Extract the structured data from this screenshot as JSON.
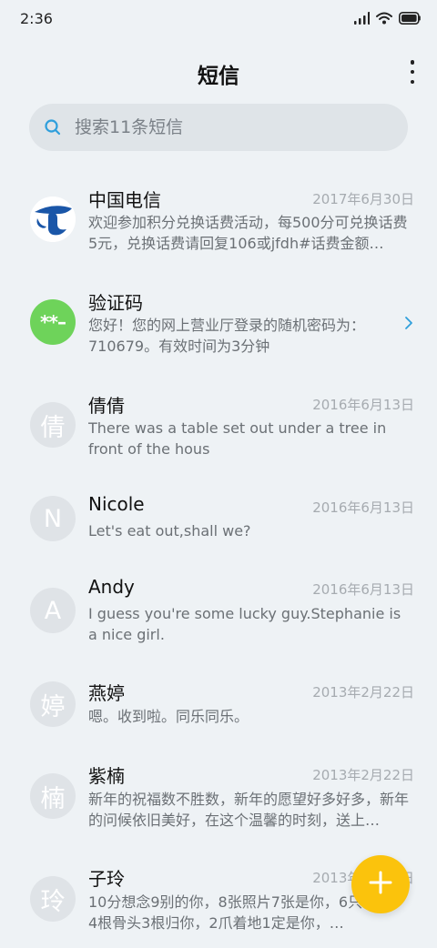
{
  "status_bar": {
    "time": "2:36"
  },
  "header": {
    "title": "短信"
  },
  "search": {
    "placeholder": "搜索11条短信"
  },
  "messages": [
    {
      "avatar_type": "logo",
      "avatar_icon": "china-telecom-logo",
      "sender": "中国电信",
      "date": "2017年6月30日",
      "preview": "欢迎参加积分兑换话费活动，每500分可兑换话费5元，兑换话费请回复106或jfdh#话费金额…"
    },
    {
      "avatar_type": "green",
      "avatar_text": "**–",
      "sender": "验证码",
      "date": "",
      "preview": "您好！您的网上营业厅登录的随机密码为：710679。有效时间为3分钟",
      "has_chevron": true
    },
    {
      "avatar_type": "letter",
      "avatar_text": "倩",
      "sender": "倩倩",
      "date": "2016年6月13日",
      "preview": "There was a table set out under a tree in front of the hous"
    },
    {
      "avatar_type": "letter",
      "avatar_text": "N",
      "sender": "Nicole",
      "date": "2016年6月13日",
      "preview": "Let's eat out,shall we?"
    },
    {
      "avatar_type": "letter",
      "avatar_text": "A",
      "sender": "Andy",
      "date": "2016年6月13日",
      "preview": "I guess you're some lucky guy.Stephanie is a nice girl."
    },
    {
      "avatar_type": "letter",
      "avatar_text": "婷",
      "sender": "燕婷",
      "date": "2013年2月22日",
      "preview": "嗯。收到啦。同乐同乐。"
    },
    {
      "avatar_type": "letter",
      "avatar_text": "楠",
      "sender": "紫楠",
      "date": "2013年2月22日",
      "preview": "新年的祝福数不胜数，新年的愿望好多好多，新年的问候依旧美好，在这个温馨的时刻，送上…"
    },
    {
      "avatar_type": "letter",
      "avatar_text": "玲",
      "sender": "子玲",
      "date": "2013年2月22日",
      "preview": "10分想念9别的你，8张照片7张是你，6只像你，4根骨头3根归你，2爪着地1定是你，…"
    }
  ],
  "fab": {
    "icon": "plus-icon",
    "color": "#fbc30c"
  },
  "colors": {
    "background": "#eef2f5",
    "accent": "#fbc30c",
    "green_avatar": "#6ed35a",
    "telecom_blue": "#1a56a8"
  }
}
